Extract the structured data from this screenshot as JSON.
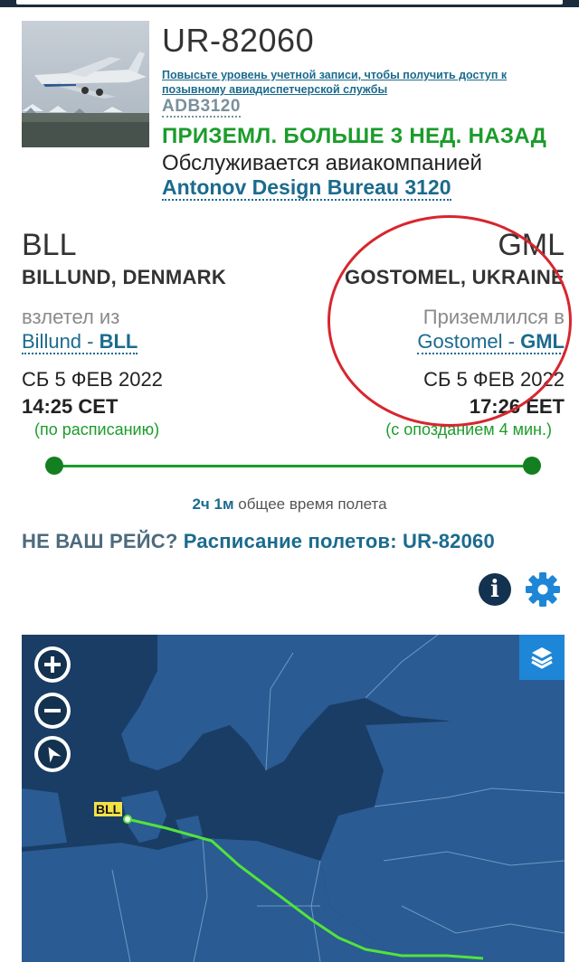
{
  "flight": {
    "registration": "UR-82060",
    "upgrade_text": "Повысьте уровень учетной записи, чтобы получить доступ к позывному авиадиспетчерской службы",
    "callsign": "ADB3120",
    "status": "ПРИЗЕМЛ. БОЛЬШЕ 3 НЕД. НАЗАД",
    "operated_by": "Обслуживается авиакомпанией",
    "airline": "Antonov Design Bureau 3120"
  },
  "origin": {
    "iata": "BLL",
    "city": "BILLUND, DENMARK",
    "label": "взлетел из",
    "link_name": "Billund - ",
    "link_code": "BLL",
    "date": "СБ 5 ФЕВ 2022",
    "time": "14:25 CET",
    "note": "(по расписанию)"
  },
  "destination": {
    "iata": "GML",
    "city": "GOSTOMEL, UKRAINE",
    "label": "Приземлился в",
    "link_name": "Gostomel - ",
    "link_code": "GML",
    "date": "СБ 5 ФЕВ 2022",
    "time": "17:26 EET",
    "note": "(с опозданием 4 мин.)"
  },
  "progress": {
    "fraction_complete": 1.0,
    "color": "#1b9c2a"
  },
  "duration": {
    "value": "2ч 1м",
    "label": " общее время полета"
  },
  "not_yours": {
    "prefix": "НЕ ВАШ РЕЙС? ",
    "link": "Расписание полетов: UR-82060"
  },
  "icons": [
    "info-icon",
    "gear-icon",
    "zoom-in-icon",
    "zoom-out-icon",
    "compass-icon",
    "layers-icon"
  ],
  "map": {
    "origin_label": "BLL",
    "route_color": "#52e33a",
    "sea_color": "#1a3d66",
    "land_color": "#2a5b93"
  },
  "annotation": {
    "color": "#d7262e"
  }
}
